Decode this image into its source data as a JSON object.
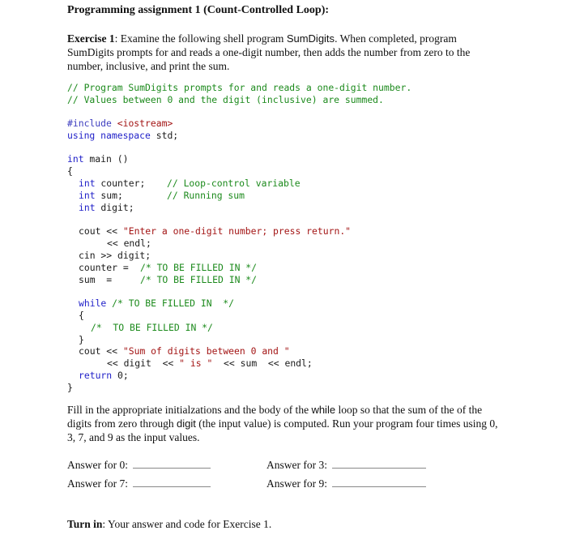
{
  "title": "Programming assignment 1 (Count-Controlled Loop):",
  "exercise": {
    "label": "Exercise 1",
    "text_before": ": Examine the following shell program ",
    "program_name": "SumDigits",
    "text_after": ". When completed, program SumDigits prompts for and reads a one-digit number, then adds the number from zero to the number, inclusive, and print the sum."
  },
  "code": {
    "comment1": "// Program SumDigits prompts for and reads a one-digit number.",
    "comment2": "// Values between 0 and the digit (inclusive) are summed.",
    "include_kw": "#include",
    "include_lib": "<iostream>",
    "using_kw": "using namespace",
    "using_rest": " std;",
    "main_kw": "int",
    "main_rest": " main ()",
    "open_brace": "{",
    "decl_counter_kw": "int",
    "decl_counter": " counter;",
    "decl_counter_comment": "// Loop-control variable",
    "decl_sum_kw": "int",
    "decl_sum": " sum;",
    "decl_sum_comment": "// Running sum",
    "decl_digit_kw": "int",
    "decl_digit": " digit;",
    "cout1_pre": "cout << ",
    "cout1_str": "\"Enter a one-digit number; press return.\"",
    "cout1_cont": "<< endl;",
    "cin": "cin >> digit;",
    "counter_assign": "counter = ",
    "counter_comment": "/* TO BE FILLED IN */",
    "sum_assign": "sum  =",
    "sum_comment": "/* TO BE FILLED IN */",
    "while_kw": "while",
    "while_comment": " /* TO BE FILLED IN  */",
    "while_open": "{",
    "body_comment": "/*  TO BE FILLED IN */",
    "while_close": "}",
    "cout2_pre": "cout << ",
    "cout2_str": "\"Sum of digits between 0 and \"",
    "cout2_cont_a": "<< digit  << ",
    "cout2_str2": "\" is \"",
    "cout2_cont_b": "  << sum  << endl;",
    "return_kw": "return",
    "return_rest": " 0;",
    "close_brace": "}"
  },
  "instructions": {
    "part1": "Fill in the appropriate initialzations and the body of the ",
    "while_word": "while",
    "part2": " loop so that the sum of the of the digits from zero through ",
    "digit_word": "digit",
    "part3": " (the input value) is computed. Run your program four times using 0, 3, 7, and 9 as the input values."
  },
  "answers": [
    {
      "label": "Answer for 0:",
      "value": ""
    },
    {
      "label": "Answer for 3:",
      "value": ""
    },
    {
      "label": "Answer for 7:",
      "value": ""
    },
    {
      "label": "Answer for 9:",
      "value": ""
    }
  ],
  "turn_in": {
    "label": "Turn in",
    "text": ": Your answer and code for Exercise 1."
  }
}
